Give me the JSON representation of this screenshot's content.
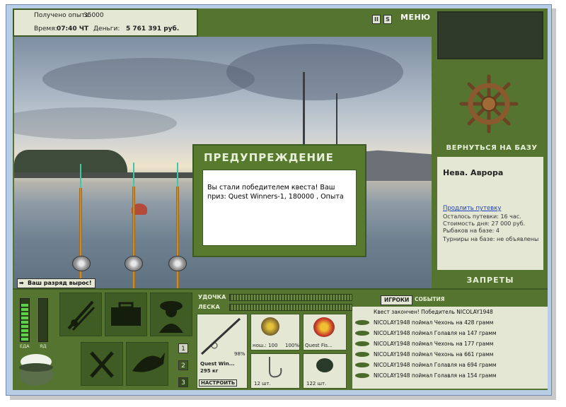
{
  "top": {
    "experience_label": "Получено опыта:",
    "experience_value": "35000",
    "time_label": "Время:",
    "time_value": "07:40 ЧТ",
    "money_label": "Деньги:",
    "money_value": "5 761 391 руб.",
    "btn_pause": "II",
    "btn_s": "S",
    "menu_label": "МЕНЮ"
  },
  "dialog": {
    "title": "ПРЕДУПРЕЖДЕНИЕ",
    "message": "Вы стали победителем квеста! Ваш приз: Quest Winners-1, 180000 , Опыта"
  },
  "right": {
    "return_label": "ВЕРНУТЬСЯ НА БАЗУ",
    "location": "Нева. Аврора",
    "extend_link": "Продлить путевку",
    "remaining": "Осталось путевки: 16 час.",
    "day_cost": "Стоимость дня: 27 000 руб.",
    "fishers": "Рыбаков на базе: 4",
    "tournaments": "Турниры на базе: не объявлены",
    "bans_label": "ЗАПРЕТЫ"
  },
  "rank_message": "Ваш разряд вырос!",
  "bottom": {
    "food_label": "ЕДА",
    "poison_label": "ЯД",
    "page_buttons": [
      "1",
      "2",
      "3"
    ],
    "rod_label": "УДОЧКА",
    "line_label": "ЛЕСКА",
    "rod_name": "Quest Win...",
    "rod_weight": "295 кг",
    "rod_percent": "98%",
    "setup_button": "НАСТРОИТЬ",
    "reel_label": "нош.: 100",
    "reel_percent": "100%",
    "lure_label": "Quest Fis...",
    "hook_count": "12 шт.",
    "bait_count": "122 шт."
  },
  "players": {
    "tab_players": "ИГРОКИ",
    "tab_events": "СОБЫТИЯ",
    "events": [
      "Квест закончен! Победитель NICOLAY1948",
      "NICOLAY1948 поймал Чехонь на 428 грамм",
      "NICOLAY1948 поймал Голавля на 147 грамм",
      "NICOLAY1948 поймал Чехонь на 177 грамм",
      "NICOLAY1948 поймал Чехонь на 661 грамм",
      "NICOLAY1948 поймал Голавля на 694 грамм",
      "NICOLAY1948 поймал Голавля на 154 грамм"
    ]
  },
  "colors": {
    "panel_green": "#54742f",
    "dark_green": "#3d5a24",
    "cream": "#e4e7d4"
  }
}
